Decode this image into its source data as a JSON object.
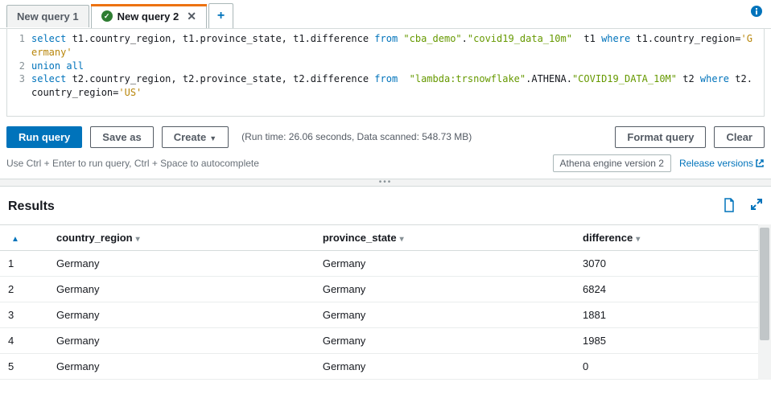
{
  "tabs": {
    "inactive": "New query 1",
    "active": "New query 2",
    "add": "+"
  },
  "editor": {
    "line1_num": "1",
    "line2_num": "2",
    "line3_num": "3",
    "l1_select": "select",
    "l1_cols": " t1.country_region, t1.province_state, t1.difference ",
    "l1_from": "from",
    "l1_sp1": " ",
    "l1_db": "\"cba_demo\"",
    "l1_dot": ".",
    "l1_tbl": "\"covid19_data_10m\"",
    "l1_alias": "  t1 ",
    "l1_where": "where",
    "l1_cond_a": " t1.country_region=",
    "l1_cond_b": "'Germany'",
    "l2_union": "union",
    "l2_sp": " ",
    "l2_all": "all",
    "l3_select": "select",
    "l3_cols": " t2.country_region, t2.province_state, t2.difference ",
    "l3_from": "from",
    "l3_sp1": "  ",
    "l3_conn": "\"lambda:trsnowflake\"",
    "l3_dot1": ".",
    "l3_schema": "ATHENA",
    "l3_dot2": ".",
    "l3_tbl": "\"COVID19_DATA_10M\"",
    "l3_alias": " t2 ",
    "l3_where": "where",
    "l3_cond_a": " t2.country_region=",
    "l3_cond_b": "'US'"
  },
  "actions": {
    "run": "Run query",
    "save": "Save as",
    "create": "Create",
    "runtime": "(Run time: 26.06 seconds, Data scanned: 548.73 MB)",
    "format": "Format query",
    "clear": "Clear"
  },
  "hints": {
    "text": "Use Ctrl + Enter to run query, Ctrl + Space to autocomplete",
    "engine": "Athena engine version 2",
    "release": "Release versions"
  },
  "results": {
    "title": "Results",
    "headers": {
      "idx_sort": "▲",
      "col1": "country_region",
      "col2": "province_state",
      "col3": "difference"
    },
    "rows": [
      {
        "n": "1",
        "a": "Germany",
        "b": "Germany",
        "c": "3070"
      },
      {
        "n": "2",
        "a": "Germany",
        "b": "Germany",
        "c": "6824"
      },
      {
        "n": "3",
        "a": "Germany",
        "b": "Germany",
        "c": "1881"
      },
      {
        "n": "4",
        "a": "Germany",
        "b": "Germany",
        "c": "1985"
      },
      {
        "n": "5",
        "a": "Germany",
        "b": "Germany",
        "c": "0"
      }
    ]
  }
}
